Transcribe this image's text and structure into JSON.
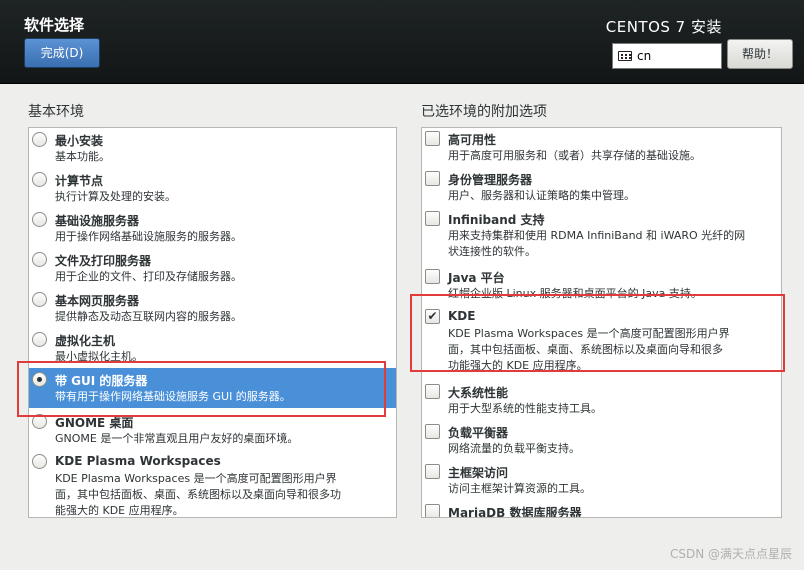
{
  "header": {
    "title": "软件选择",
    "done_label": "完成(D)",
    "product": "CENTOS 7 安装",
    "keyboard_layout": "cn",
    "help_label": "帮助！"
  },
  "environments": {
    "heading": "基本环境",
    "items": [
      {
        "name": "最小安装",
        "desc": "基本功能。",
        "selected": false
      },
      {
        "name": "计算节点",
        "desc": "执行计算及处理的安装。",
        "selected": false
      },
      {
        "name": "基础设施服务器",
        "desc": "用于操作网络基础设施服务的服务器。",
        "selected": false
      },
      {
        "name": "文件及打印服务器",
        "desc": "用于企业的文件、打印及存储服务器。",
        "selected": false
      },
      {
        "name": "基本网页服务器",
        "desc": "提供静态及动态互联网内容的服务器。",
        "selected": false
      },
      {
        "name": "虚拟化主机",
        "desc": "最小虚拟化主机。",
        "selected": false
      },
      {
        "name": "带 GUI 的服务器",
        "desc": "带有用于操作网络基础设施服务 GUI 的服务器。",
        "selected": true
      },
      {
        "name": "GNOME 桌面",
        "desc": "GNOME 是一个非常直观且用户友好的桌面环境。",
        "selected": false
      },
      {
        "name": "KDE Plasma Workspaces",
        "desc": "KDE Plasma Workspaces 是一个高度可配置图形用户界面，其中包括面板、桌面、系统图标以及桌面向导和很多功能强大的 KDE 应用程序。",
        "desc_lines": [
          "KDE Plasma Workspaces 是一个高度可配置图形用户界",
          "面，其中包括面板、桌面、系统图标以及桌面向导和很多功",
          "能强大的 KDE 应用程序。"
        ],
        "selected": false
      }
    ]
  },
  "addons": {
    "heading": "已选环境的附加选项",
    "items": [
      {
        "name": "高可用性",
        "desc_lines": [
          "用于高度可用服务和（或者）共享存储的基础设施。"
        ],
        "checked": false
      },
      {
        "name": "身份管理服务器",
        "desc_lines": [
          "用户、服务器和认证策略的集中管理。"
        ],
        "checked": false
      },
      {
        "name": "Infiniband 支持",
        "desc_lines": [
          "用来支持集群和使用 RDMA InfiniBand 和 iWARO 光纤的网",
          "状连接性的软件。"
        ],
        "checked": false
      },
      {
        "name": "Java 平台",
        "desc_lines": [
          "红帽企业版 Linux 服务器和桌面平台的 Java 支持。"
        ],
        "checked": false
      },
      {
        "name": "KDE",
        "desc_lines": [
          "KDE Plasma Workspaces 是一个高度可配置图形用户界",
          "面，其中包括面板、桌面、系统图标以及桌面向导和很多",
          "功能强大的 KDE 应用程序。"
        ],
        "checked": true
      },
      {
        "name": "大系统性能",
        "desc_lines": [
          "用于大型系统的性能支持工具。"
        ],
        "checked": false
      },
      {
        "name": "负载平衡器",
        "desc_lines": [
          "网络流量的负载平衡支持。"
        ],
        "checked": false
      },
      {
        "name": "主框架访问",
        "desc_lines": [
          "访问主框架计算资源的工具。"
        ],
        "checked": false
      },
      {
        "name": "MariaDB 数据库服务器",
        "desc_lines": [],
        "checked": false
      }
    ]
  },
  "check_mark": "✔",
  "watermark": "CSDN @满天点点星辰",
  "colors": {
    "accent": "#4a90d9",
    "annotation": "#e23b3b",
    "header_bg": "#1a1e1f"
  }
}
